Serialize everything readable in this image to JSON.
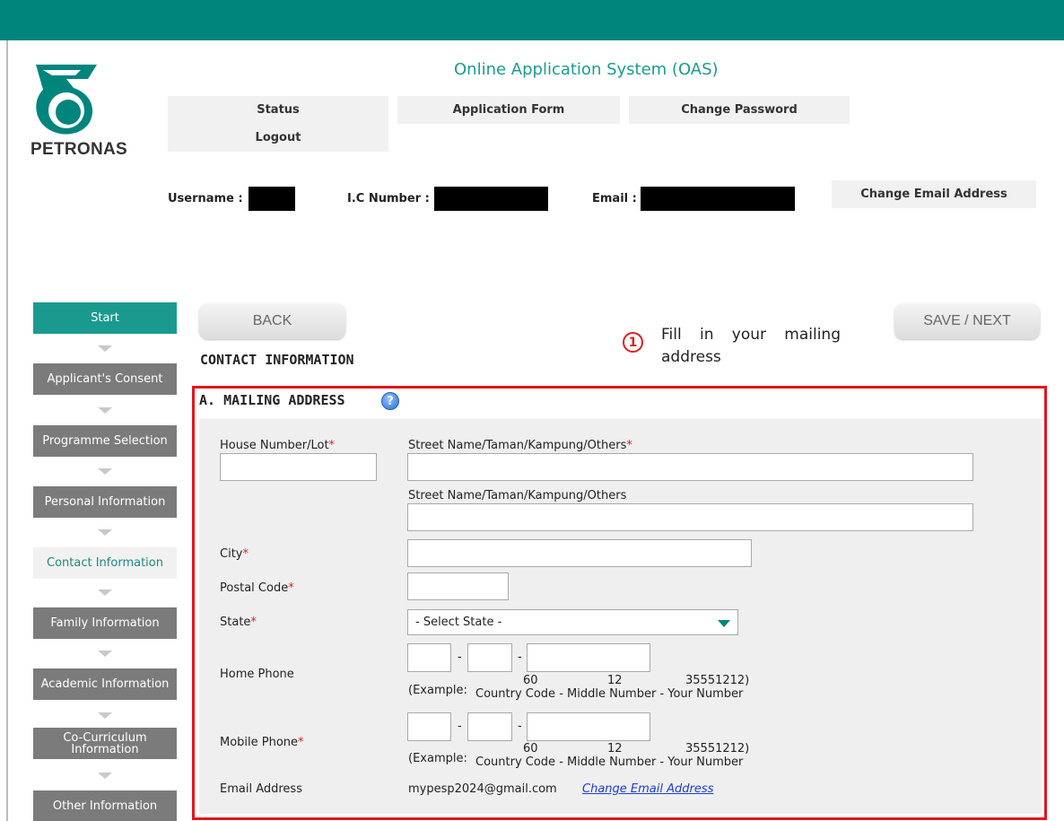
{
  "header": {
    "app_title": "Online Application System (OAS)",
    "logo_text": "PETRONAS",
    "brand_color": "#00857c"
  },
  "nav": {
    "status": "Status",
    "application_form": "Application Form",
    "change_password": "Change Password",
    "logout": "Logout"
  },
  "user_info": {
    "username_label": "Username :",
    "ic_label": "I.C Number :",
    "email_label": "Email :",
    "change_email_button": "Change Email Address"
  },
  "steps": [
    "Start",
    "Applicant's Consent",
    "Programme Selection",
    "Personal Information",
    "Contact Information",
    "Family Information",
    "Academic Information",
    "Co-Curriculum Information",
    "Other Information"
  ],
  "buttons": {
    "back": "BACK",
    "save_next": "SAVE / NEXT"
  },
  "section_title": "CONTACT INFORMATION",
  "callout": {
    "number": "1",
    "text": "Fill in your mailing address"
  },
  "mailing": {
    "title": "A. MAILING ADDRESS",
    "house_label": "House Number/Lot",
    "street1_label": "Street Name/Taman/Kampung/Others",
    "street2_label": "Street Name/Taman/Kampung/Others",
    "city_label": "City",
    "postal_label": "Postal Code",
    "state_label": "State",
    "state_selected": "- Select State -",
    "home_phone_label": "Home Phone",
    "mobile_phone_label": "Mobile Phone",
    "example_prefix": "(Example:",
    "example_country": "60",
    "example_middle": "12",
    "example_number": "35551212)",
    "example_legend": "Country Code - Middle Number - Your Number",
    "email_label": "Email Address",
    "email_value": "mypesp2024@gmail.com",
    "change_email_link": "Change Email Address",
    "required_mark": "*",
    "dash": "-"
  }
}
